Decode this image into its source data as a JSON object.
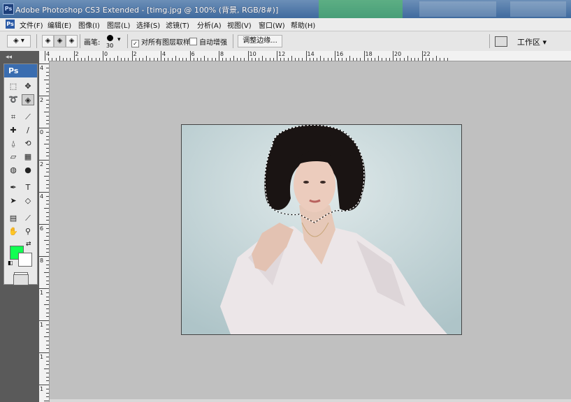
{
  "titlebar": {
    "title": "Adobe Photoshop CS3 Extended - [timg.jpg @ 100% (背景, RGB/8#)]",
    "app_icon": "Ps"
  },
  "menu": {
    "doc_icon": "Ps",
    "items": [
      "文件(F)",
      "编辑(E)",
      "图像(I)",
      "图层(L)",
      "选择(S)",
      "滤镜(T)",
      "分析(A)",
      "视图(V)",
      "窗口(W)",
      "帮助(H)"
    ]
  },
  "options": {
    "brush_label": "画笔:",
    "brush_size": "30",
    "sample_all_label": "对所有图层取样",
    "sample_all_checked": true,
    "auto_enhance_label": "自动增强",
    "auto_enhance_checked": false,
    "refine_edge_label": "调整边缘...",
    "workspace_label": "工作区",
    "workspace_arrow": "▾"
  },
  "toolbox": {
    "logo": "Ps",
    "collapse": "◂◂",
    "tools": [
      {
        "name": "rect-marquee",
        "glyph": "⬚"
      },
      {
        "name": "move",
        "glyph": "✥"
      },
      {
        "name": "lasso",
        "glyph": "➰"
      },
      {
        "name": "quick-select",
        "glyph": "◈"
      },
      {
        "name": "crop",
        "glyph": "⌗"
      },
      {
        "name": "slice",
        "glyph": "⟋"
      },
      {
        "name": "healing",
        "glyph": "✚"
      },
      {
        "name": "brush",
        "glyph": "∕"
      },
      {
        "name": "stamp",
        "glyph": "⍙"
      },
      {
        "name": "history-brush",
        "glyph": "⟲"
      },
      {
        "name": "eraser",
        "glyph": "▱"
      },
      {
        "name": "gradient",
        "glyph": "▦"
      },
      {
        "name": "blur",
        "glyph": "◍"
      },
      {
        "name": "dodge",
        "glyph": "●"
      },
      {
        "name": "pen",
        "glyph": "✒"
      },
      {
        "name": "type",
        "glyph": "T"
      },
      {
        "name": "path-select",
        "glyph": "➤"
      },
      {
        "name": "shape",
        "glyph": "◇"
      },
      {
        "name": "notes",
        "glyph": "▤"
      },
      {
        "name": "eyedropper",
        "glyph": "⟋"
      },
      {
        "name": "hand",
        "glyph": "✋"
      },
      {
        "name": "zoom",
        "glyph": "⚲"
      }
    ],
    "fg_color": "#12ff52",
    "bg_color": "#ffffff"
  },
  "rulers": {
    "h": [
      "4",
      "2",
      "0",
      "2",
      "4",
      "6",
      "8",
      "10",
      "12",
      "14",
      "16",
      "18",
      "20",
      "22"
    ],
    "v": [
      "4",
      "2",
      "0",
      "2",
      "4",
      "6",
      "8",
      "1",
      "1",
      "1",
      "1"
    ]
  }
}
